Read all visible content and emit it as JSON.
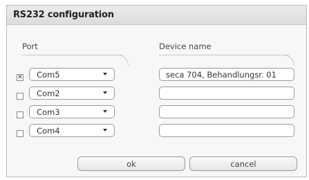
{
  "dialog": {
    "title": "RS232 configuration",
    "columns": {
      "port": "Port",
      "device": "Device name"
    },
    "rows": [
      {
        "checked": true,
        "check_glyph": "✕",
        "port": "Com5",
        "device_name": "seca 704, Behandlungsr. 01"
      },
      {
        "checked": false,
        "check_glyph": "",
        "port": "Com2",
        "device_name": ""
      },
      {
        "checked": false,
        "check_glyph": "",
        "port": "Com3",
        "device_name": ""
      },
      {
        "checked": false,
        "check_glyph": "",
        "port": "Com4",
        "device_name": ""
      }
    ],
    "buttons": {
      "ok": "ok",
      "cancel": "cancel"
    }
  }
}
